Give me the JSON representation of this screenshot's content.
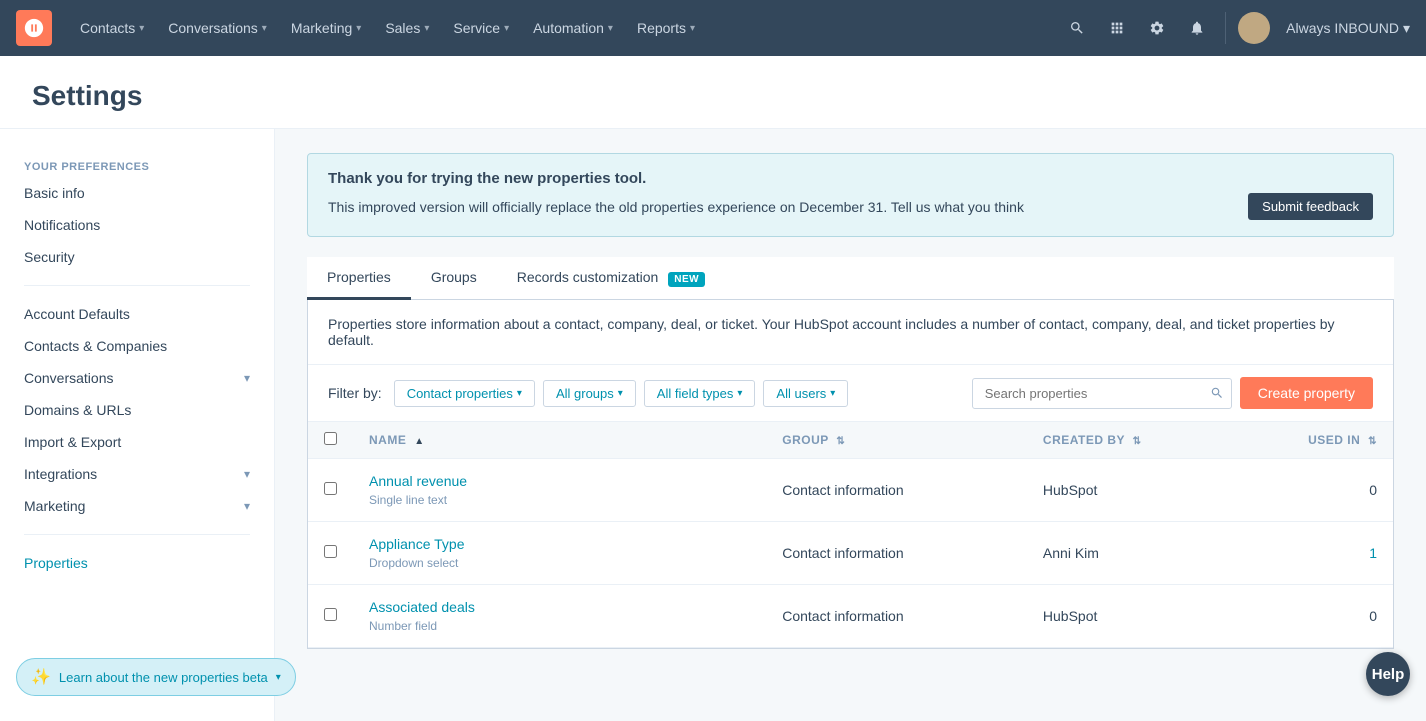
{
  "nav": {
    "items": [
      {
        "label": "Contacts",
        "id": "contacts"
      },
      {
        "label": "Conversations",
        "id": "conversations"
      },
      {
        "label": "Marketing",
        "id": "marketing"
      },
      {
        "label": "Sales",
        "id": "sales"
      },
      {
        "label": "Service",
        "id": "service"
      },
      {
        "label": "Automation",
        "id": "automation"
      },
      {
        "label": "Reports",
        "id": "reports"
      }
    ],
    "account_name": "Always INBOUND"
  },
  "page": {
    "title": "Settings"
  },
  "sidebar": {
    "section1": {
      "label": "Your preferences",
      "items": [
        {
          "label": "Basic info",
          "id": "basic-info"
        },
        {
          "label": "Notifications",
          "id": "notifications"
        },
        {
          "label": "Security",
          "id": "security"
        }
      ]
    },
    "section2": {
      "items": [
        {
          "label": "Account Defaults",
          "id": "account-defaults"
        },
        {
          "label": "Contacts & Companies",
          "id": "contacts-companies"
        },
        {
          "label": "Conversations",
          "id": "conversations",
          "hasChevron": true
        },
        {
          "label": "Domains & URLs",
          "id": "domains-urls"
        },
        {
          "label": "Import & Export",
          "id": "import-export"
        },
        {
          "label": "Integrations",
          "id": "integrations",
          "hasChevron": true
        },
        {
          "label": "Marketing",
          "id": "marketing",
          "hasChevron": true
        }
      ]
    },
    "section3": {
      "items": [
        {
          "label": "Properties",
          "id": "properties",
          "active": true
        }
      ]
    }
  },
  "banner": {
    "title": "Thank you for trying the new properties tool.",
    "body": "This improved version will officially replace the old properties experience on December 31. Tell us what you think",
    "button_label": "Submit feedback"
  },
  "tabs": [
    {
      "label": "Properties",
      "id": "properties",
      "active": true,
      "badge": null
    },
    {
      "label": "Groups",
      "id": "groups",
      "active": false,
      "badge": null
    },
    {
      "label": "Records customization",
      "id": "records-customization",
      "active": false,
      "badge": "NEW"
    }
  ],
  "description": "Properties store information about a contact, company, deal, or ticket. Your HubSpot account includes a number of contact, company, deal, and ticket properties by default.",
  "filter_bar": {
    "label": "Filter by:",
    "filters": [
      {
        "label": "Contact properties",
        "id": "contact-properties"
      },
      {
        "label": "All groups",
        "id": "all-groups"
      },
      {
        "label": "All field types",
        "id": "all-field-types"
      },
      {
        "label": "All users",
        "id": "all-users"
      }
    ],
    "search_placeholder": "Search properties",
    "create_label": "Create property"
  },
  "table": {
    "columns": [
      {
        "label": "NAME",
        "id": "name",
        "sortable": true
      },
      {
        "label": "GROUP",
        "id": "group",
        "sortable": true
      },
      {
        "label": "CREATED BY",
        "id": "created-by",
        "sortable": true
      },
      {
        "label": "USED IN",
        "id": "used-in",
        "sortable": true
      }
    ],
    "rows": [
      {
        "name": "Annual revenue",
        "type": "Single line text",
        "group": "Contact information",
        "created_by": "HubSpot",
        "used_in": "0",
        "used_in_linked": false
      },
      {
        "name": "Appliance Type",
        "type": "Dropdown select",
        "group": "Contact information",
        "created_by": "Anni Kim",
        "used_in": "1",
        "used_in_linked": true
      },
      {
        "name": "Associated deals",
        "type": "Number field",
        "group": "Contact information",
        "created_by": "HubSpot",
        "used_in": "0",
        "used_in_linked": false
      }
    ]
  },
  "learn_beta": {
    "label": "Learn about the new properties beta"
  },
  "help": {
    "label": "Help"
  }
}
